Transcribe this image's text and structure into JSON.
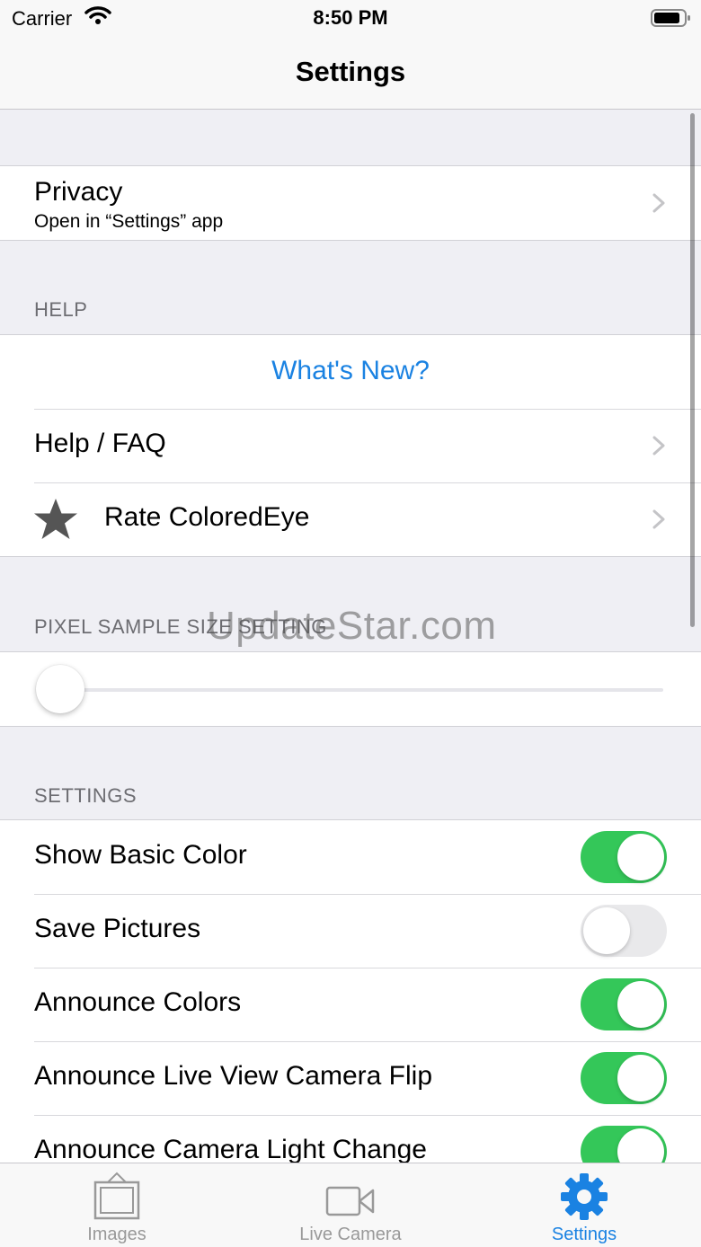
{
  "status_bar": {
    "carrier": "Carrier",
    "time": "8:50 PM"
  },
  "nav": {
    "title": "Settings"
  },
  "privacy": {
    "title": "Privacy",
    "subtitle": "Open in “Settings” app"
  },
  "help": {
    "header": "HELP",
    "whats_new": "What's New?",
    "faq": "Help / FAQ",
    "rate": "Rate ColoredEye"
  },
  "pixel_sample": {
    "header": "PIXEL SAMPLE SIZE SETTING",
    "slider_value": 0.0
  },
  "settings": {
    "header": "SETTINGS",
    "items": [
      {
        "label": "Show Basic Color",
        "on": true
      },
      {
        "label": "Save Pictures",
        "on": false
      },
      {
        "label": "Announce Colors",
        "on": true
      },
      {
        "label": "Announce Live View Camera Flip",
        "on": true
      },
      {
        "label": "Announce Camera Light Change",
        "on": true
      }
    ]
  },
  "watermark": "UpdateStar.com",
  "tabs": [
    {
      "label": "Images",
      "icon": "images-icon",
      "active": false
    },
    {
      "label": "Live Camera",
      "icon": "video-camera-icon",
      "active": false
    },
    {
      "label": "Settings",
      "icon": "gear-icon",
      "active": true
    }
  ],
  "colors": {
    "accent": "#1a82e2",
    "toggle_on": "#34c759",
    "toggle_off": "#e9e9eb",
    "inactive_tab": "#999999"
  }
}
